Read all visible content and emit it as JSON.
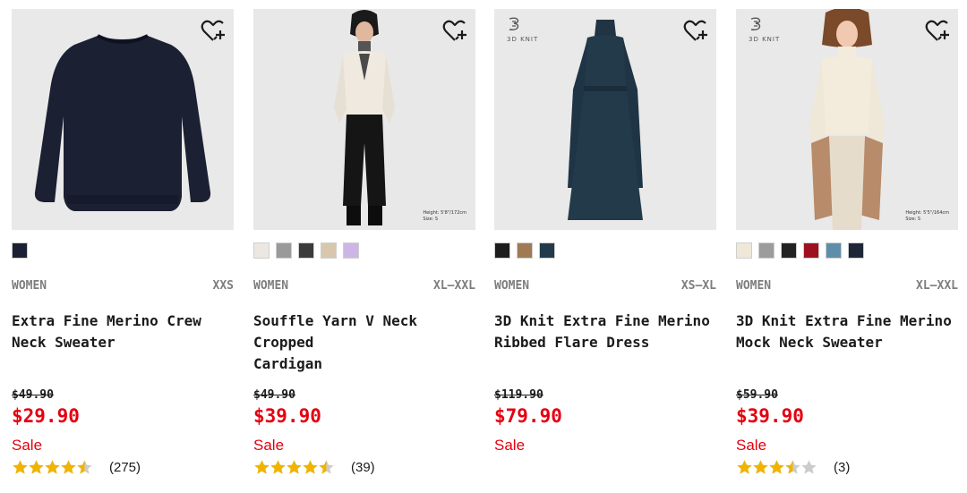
{
  "products": [
    {
      "gender": "WOMEN",
      "size": "XXS",
      "name_line1": "Extra Fine Merino Crew",
      "name_line2": "Neck Sweater",
      "original_price": "$49.90",
      "sale_price": "$29.90",
      "sale_label": "Sale",
      "rating": 4.5,
      "review_count": "(275)",
      "colors": [
        "#1c2033"
      ],
      "image_icon": "navy-crew-neck-sweater",
      "wishlist_icon": "heart-plus-icon"
    },
    {
      "gender": "WOMEN",
      "size": "XL–XXL",
      "name_line1": "Souffle Yarn V Neck Cropped",
      "name_line2": "Cardigan",
      "original_price": "$49.90",
      "sale_price": "$39.90",
      "sale_label": "Sale",
      "rating": 4.5,
      "review_count": "(39)",
      "colors": [
        "#ece7e1",
        "#9a9a9a",
        "#3a3a3a",
        "#d9c7ad",
        "#cdb6e6"
      ],
      "image_icon": "model-in-cropped-cardigan",
      "image_caption": [
        "Height: 5'8\"/172cm",
        "Size: S"
      ],
      "wishlist_icon": "heart-plus-icon"
    },
    {
      "gender": "WOMEN",
      "size": "XS–XL",
      "name_line1": "3D Knit Extra Fine Merino",
      "name_line2": "Ribbed Flare Dress",
      "original_price": "$119.90",
      "sale_price": "$79.90",
      "sale_label": "Sale",
      "rating": null,
      "review_count": "",
      "colors": [
        "#1d1d1d",
        "#a07a52",
        "#233a4a"
      ],
      "image_icon": "teal-ribbed-flare-dress",
      "badge": "3D KNIT",
      "wishlist_icon": "heart-plus-icon"
    },
    {
      "gender": "WOMEN",
      "size": "XL–XXL",
      "name_line1": "3D Knit Extra Fine Merino",
      "name_line2": "Mock Neck Sweater",
      "original_price": "$59.90",
      "sale_price": "$39.90",
      "sale_label": "Sale",
      "rating": 3.5,
      "review_count": "(3)",
      "colors": [
        "#efe8d8",
        "#9c9c9c",
        "#222222",
        "#9e1020",
        "#5f8fa8",
        "#1e2638"
      ],
      "image_icon": "model-in-mock-neck-sweater",
      "badge": "3D KNIT",
      "image_caption": [
        "Height: 5'5\"/164cm",
        "Size: S"
      ],
      "wishlist_icon": "heart-plus-icon"
    }
  ],
  "theme": {
    "sale_color": "#e4000f",
    "star_color": "#f0b400",
    "star_empty_color": "#cccccc",
    "image_bg": "#e9e9e9"
  }
}
